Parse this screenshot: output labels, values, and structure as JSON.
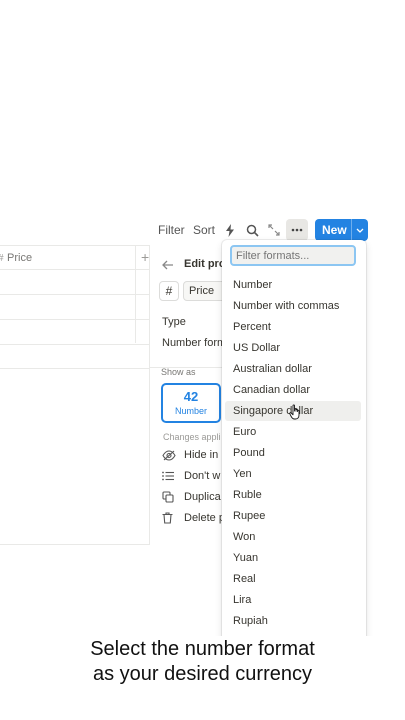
{
  "toolbar": {
    "filter_label": "Filter",
    "sort_label": "Sort",
    "new_label": "New",
    "icons": [
      "lightning-icon",
      "search-icon",
      "expand-icon",
      "more-icon",
      "chevron-down-icon"
    ]
  },
  "table": {
    "header_label": "Price",
    "add_column_label": "+"
  },
  "panel": {
    "title": "Edit pro",
    "type_icon": "#",
    "property_name": "Price",
    "type_label": "Type",
    "number_format_label": "Number form",
    "show_as_label": "Show as",
    "show_as_value": "42",
    "show_as_option": "Number",
    "note": "Changes appli",
    "items": [
      {
        "label": "Hide in",
        "icon": "eye-off-icon"
      },
      {
        "label": "Don't w",
        "icon": "list-icon"
      },
      {
        "label": "Duplica",
        "icon": "duplicate-icon"
      },
      {
        "label": "Delete p",
        "icon": "trash-icon"
      }
    ]
  },
  "dropdown": {
    "filter_placeholder": "Filter formats...",
    "highlighted": "Singapore dollar",
    "options": [
      "Number",
      "Number with commas",
      "Percent",
      "US Dollar",
      "Australian dollar",
      "Canadian dollar",
      "Singapore dollar",
      "Euro",
      "Pound",
      "Yen",
      "Ruble",
      "Rupee",
      "Won",
      "Yuan",
      "Real",
      "Lira",
      "Rupiah"
    ]
  },
  "caption": {
    "line1": "Select the number format",
    "line2": "as your desired currency"
  },
  "colors": {
    "accent": "#2383e2",
    "text": "#37352f",
    "muted": "#787774"
  }
}
